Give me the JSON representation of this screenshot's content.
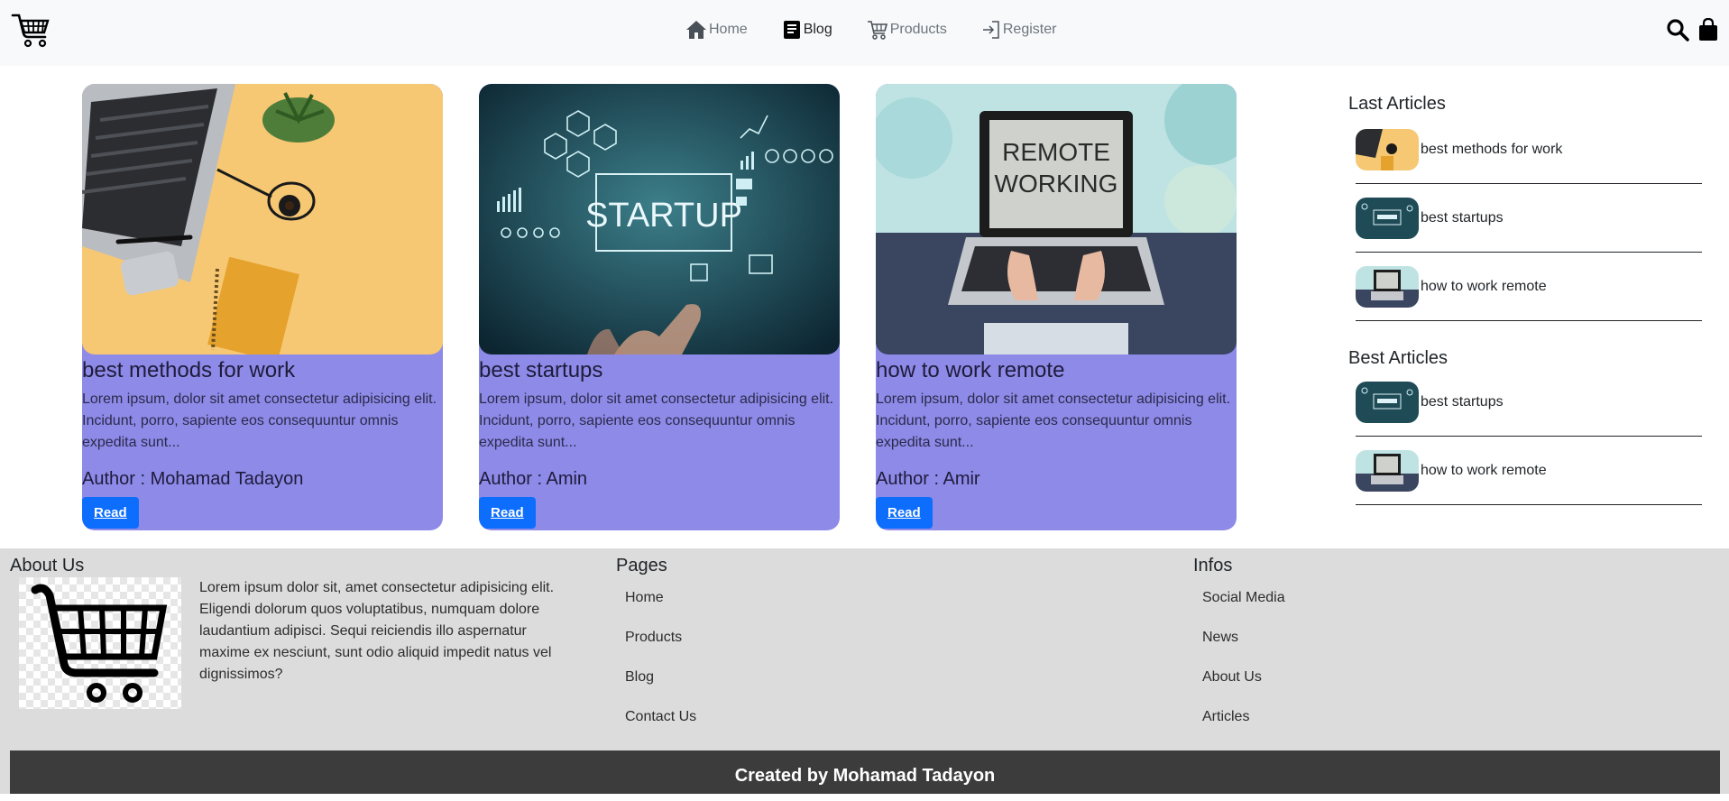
{
  "nav": {
    "links": [
      {
        "label": "Home",
        "icon": "house-icon",
        "active": false
      },
      {
        "label": "Blog",
        "icon": "journal-icon",
        "active": true
      },
      {
        "label": "Products",
        "icon": "cart-icon",
        "active": false
      },
      {
        "label": "Register",
        "icon": "login-icon",
        "active": false
      }
    ],
    "right_icons": [
      "search-icon",
      "bag-icon"
    ],
    "logo_icon": "shopping-cart-logo"
  },
  "cards": [
    {
      "title": "best methods for work",
      "text": "Lorem ipsum, dolor sit amet consectetur adipisicing elit. Incidunt, porro, sapiente eos consequuntur omnis expedita sunt...",
      "author": "Author : Mohamad Tadayon",
      "button": "Read"
    },
    {
      "title": "best startups",
      "text": "Lorem ipsum, dolor sit amet consectetur adipisicing elit. Incidunt, porro, sapiente eos consequuntur omnis expedita sunt...",
      "author": "Author : Amin",
      "button": "Read"
    },
    {
      "title": "how to work remote",
      "text": "Lorem ipsum, dolor sit amet consectetur adipisicing elit. Incidunt, porro, sapiente eos consequuntur omnis expedita sunt...",
      "author": "Author : Amir",
      "button": "Read"
    }
  ],
  "image_text": {
    "startup": "STARTUP",
    "remote_line1": "REMOTE",
    "remote_line2": "WORKING"
  },
  "sidebar": {
    "last_heading": "Last Articles",
    "last_items": [
      "best methods for work",
      "best startups",
      "how to work remote"
    ],
    "best_heading": "Best Articles",
    "best_items": [
      "best startups",
      "how to work remote"
    ]
  },
  "footer": {
    "about_heading": "About Us",
    "about_text": "Lorem ipsum dolor sit, amet consectetur adipisicing elit. Eligendi dolorum quos voluptatibus, numquam dolore laudantium adipisci. Sequi reiciendis illo aspernatur maxime ex nesciunt, sunt odio aliquid impedit natus vel dignissimos?",
    "pages_heading": "Pages",
    "pages": [
      "Home",
      "Products",
      "Blog",
      "Contact Us"
    ],
    "infos_heading": "Infos",
    "infos": [
      "Social Media",
      "News",
      "About Us",
      "Articles"
    ],
    "credit": "Created by Mohamad Tadayon"
  },
  "colors": {
    "card_bg": "#8d8ae8",
    "button": "#0d6efd",
    "navbar": "#f8f9fa",
    "footer": "#dcdcdc",
    "credit_bar": "#3c3c3c"
  }
}
